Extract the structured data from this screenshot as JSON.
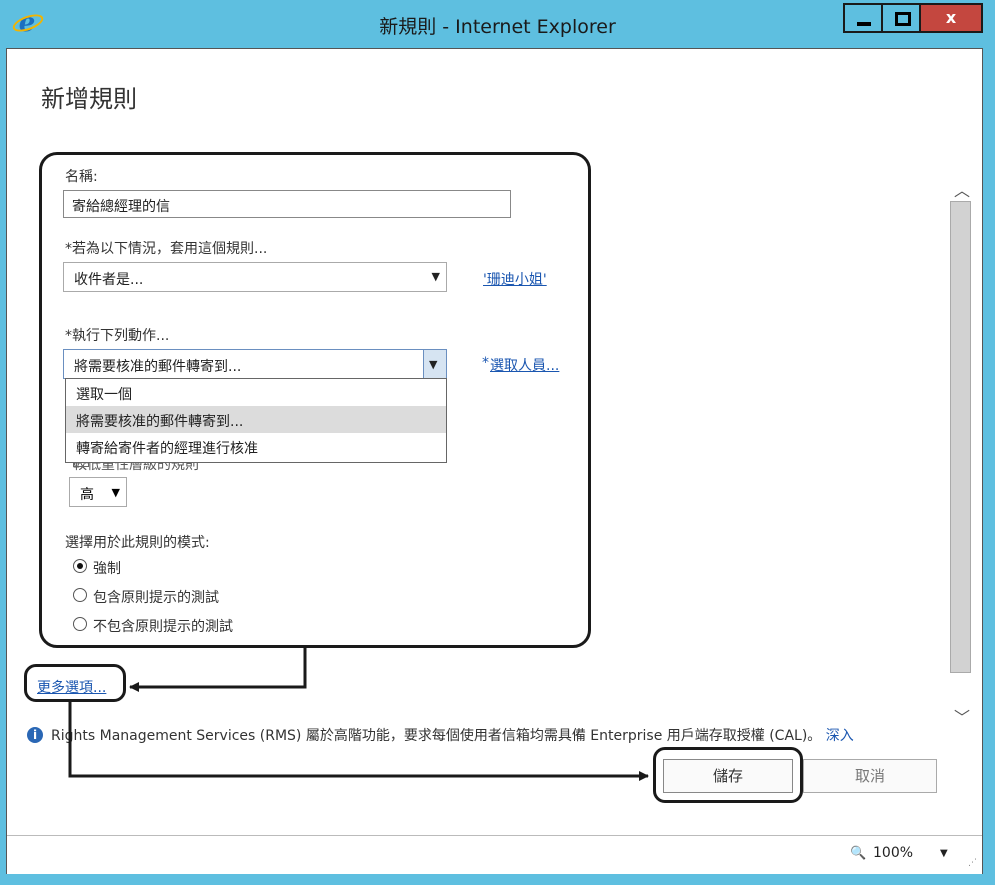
{
  "window": {
    "title": "新規則 - Internet Explorer",
    "close_label": "x"
  },
  "page": {
    "title": "新增規則"
  },
  "form": {
    "name_label": "名稱:",
    "name_value": "寄給總經理的信",
    "condition_label": "*若為以下情況，套用這個規則...",
    "condition_value": "收件者是...",
    "condition_link": "'珊迪小姐'",
    "action_label": "*執行下列動作...",
    "action_value": "將需要核准的郵件轉寄到...",
    "action_link_prefix": "*",
    "action_link": "選取人員...",
    "action_options": [
      "選取一個",
      "將需要核准的郵件轉寄到...",
      "轉寄給寄件者的經理進行核准"
    ],
    "action_selected_index": 1,
    "obscured_text": "較低重性層級的規則",
    "severity_value": "高",
    "mode_label": "選擇用於此規則的模式:",
    "modes": [
      {
        "label": "強制",
        "selected": true
      },
      {
        "label": "包含原則提示的測試",
        "selected": false
      },
      {
        "label": "不包含原則提示的測試",
        "selected": false
      }
    ]
  },
  "more_options": "更多選項...",
  "info": {
    "text": "Rights Management Services (RMS) 屬於高階功能，要求每個使用者信箱均需具備 Enterprise 用戶端存取授權 (CAL)。",
    "link": "深入"
  },
  "buttons": {
    "save": "儲存",
    "cancel": "取消"
  },
  "status": {
    "zoom": "100%"
  }
}
